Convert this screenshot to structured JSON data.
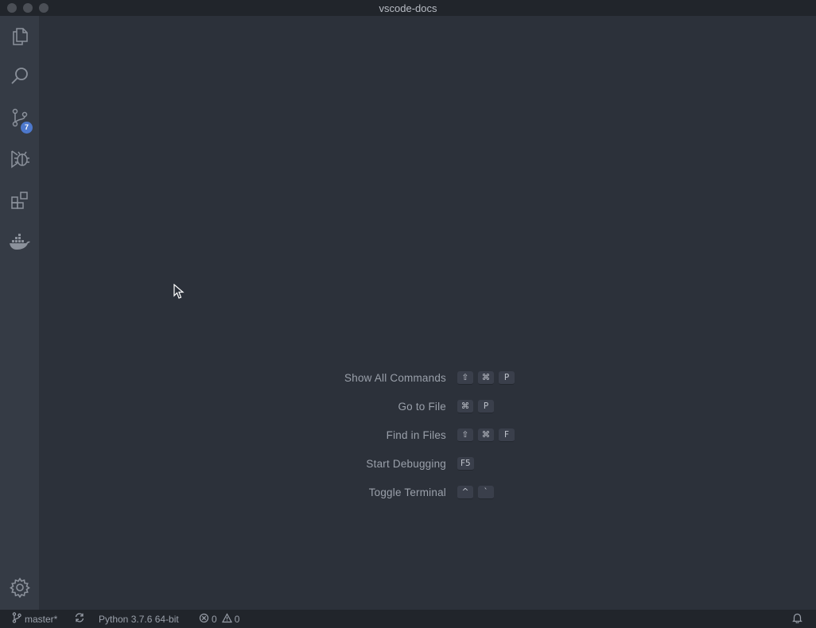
{
  "window": {
    "title": "vscode-docs"
  },
  "activity_bar": {
    "items": [
      {
        "icon": "files-icon",
        "label": "Explorer"
      },
      {
        "icon": "search-icon",
        "label": "Search"
      },
      {
        "icon": "source-control-icon",
        "label": "Source Control",
        "badge": "7"
      },
      {
        "icon": "debug-icon",
        "label": "Run and Debug"
      },
      {
        "icon": "extensions-icon",
        "label": "Extensions"
      },
      {
        "icon": "docker-icon",
        "label": "Docker"
      }
    ],
    "manage_icon": "gear-icon"
  },
  "editor": {
    "shortcuts": [
      {
        "label": "Show All Commands",
        "keys": [
          "⇧",
          "⌘",
          "P"
        ]
      },
      {
        "label": "Go to File",
        "keys": [
          "⌘",
          "P"
        ]
      },
      {
        "label": "Find in Files",
        "keys": [
          "⇧",
          "⌘",
          "F"
        ]
      },
      {
        "label": "Start Debugging",
        "keys": [
          "F5"
        ]
      },
      {
        "label": "Toggle Terminal",
        "keys": [
          "^",
          "`"
        ]
      }
    ]
  },
  "status_bar": {
    "branch": "master*",
    "python": "Python 3.7.6 64-bit",
    "errors": "0",
    "warnings": "0"
  },
  "colors": {
    "background": "#2c313a",
    "activity_bar": "#353b45",
    "status_bar": "#21252b",
    "badge": "#4d78cc",
    "text_muted": "#9aa0aa"
  }
}
